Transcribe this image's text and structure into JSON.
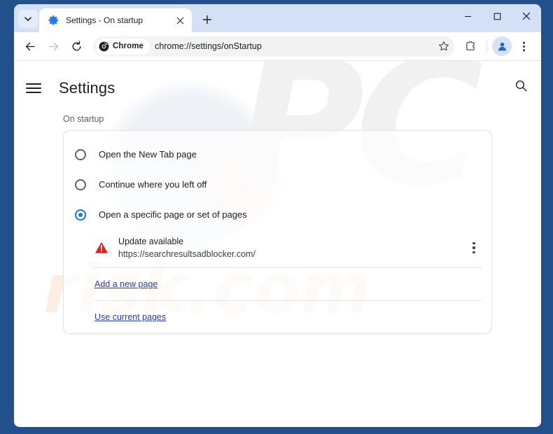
{
  "window": {
    "frame_color": "#22508d",
    "controls": {
      "minimize": "minimize-icon",
      "maximize": "maximize-icon",
      "close": "close-icon"
    }
  },
  "tabstrip": {
    "tab_search_label": "tab-search-chevron",
    "tabs": [
      {
        "title": "Settings - On startup",
        "favicon": "settings-gear-icon",
        "close_label": "close-tab-icon",
        "active": true
      }
    ],
    "new_tab_label": "+"
  },
  "toolbar": {
    "back_label": "back-arrow-icon",
    "forward_label": "forward-arrow-icon",
    "reload_label": "reload-icon",
    "chrome_chip_label": "Chrome",
    "url": "chrome://settings/onStartup",
    "bookmark_label": "star-icon",
    "extensions_label": "extensions-puzzle-icon",
    "profile_label": "profile-avatar-icon",
    "menu_label": "three-dot-menu-icon"
  },
  "settings": {
    "menu_label": "hamburger-menu",
    "title": "Settings",
    "search_label": "search-icon"
  },
  "main": {
    "section_label": "On startup",
    "options": [
      {
        "label": "Open the New Tab page",
        "selected": false
      },
      {
        "label": "Continue where you left off",
        "selected": false
      },
      {
        "label": "Open a specific page or set of pages",
        "selected": true
      }
    ],
    "startup_pages": [
      {
        "title": "Update available",
        "url": "https://searchresultsadblocker.com/",
        "icon": "warning-triangle-icon",
        "menu_label": "more-actions-icon"
      }
    ],
    "add_page_link": "Add a new page",
    "use_current_link": "Use current pages"
  },
  "watermarks": {
    "primary": "PC",
    "secondary": "risk.com"
  },
  "colors": {
    "accent": "#1a73e8",
    "frame": "#22508d",
    "warning": "#e02020",
    "link": "#2b3ea8"
  }
}
